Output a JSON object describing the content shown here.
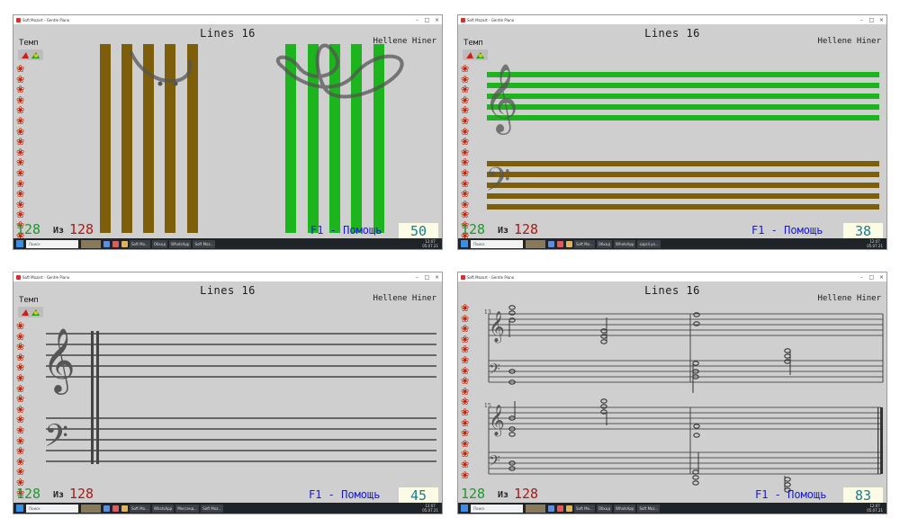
{
  "windows": [
    {
      "title_bar": "Soft Mozart - Gentle Piano",
      "lines_title": "Lines 16",
      "author": "Hellene Hiner",
      "tempo_label": "Темп",
      "count_green": "128",
      "count_sep": "Из",
      "count_red": "128",
      "help": "F1 - Помощь",
      "score": "50",
      "view": "vertical-bars"
    },
    {
      "title_bar": "Soft Mozart - Gentle Piano",
      "lines_title": "Lines 16",
      "author": "Hellene Hiner",
      "tempo_label": "Темп",
      "count_green": "128",
      "count_sep": "Из",
      "count_red": "128",
      "help": "F1 - Помощь",
      "score": "38",
      "view": "colored-staff"
    },
    {
      "title_bar": "Soft Mozart - Gentle Piano",
      "lines_title": "Lines 16",
      "author": "Hellene Hiner",
      "tempo_label": "Темп",
      "count_green": "128",
      "count_sep": "Из",
      "count_red": "128",
      "help": "F1 - Помощь",
      "score": "45",
      "view": "empty-staff"
    },
    {
      "title_bar": "Soft Mozart - Gentle Piano",
      "lines_title": "Lines 16",
      "author": "Hellene Hiner",
      "tempo_label": "",
      "count_green": "128",
      "count_sep": "Из",
      "count_red": "128",
      "help": "F1 - Помощь",
      "score": "83",
      "view": "sheet-music",
      "measure_numbers": [
        "13",
        "15"
      ]
    }
  ],
  "taskbar": {
    "search_placeholder": "Поиск",
    "apps": [
      "Soft Mo...",
      "Обход",
      "WhatsApp",
      "Мессенд...",
      "Soft Moz...",
      "sapsil.yo..."
    ],
    "clock_time": "12:07",
    "clock_date": "05.07.21",
    "lang": "РУС"
  },
  "colors": {
    "green": "#1db51d",
    "olive": "#7d5e0a",
    "flower": "#cc2200",
    "help": "#1a1acf",
    "score": "#167f8c"
  },
  "icons": [
    "flower-icon",
    "tempo-meter-icon",
    "treble-clef-icon",
    "bass-clef-icon",
    "windows-start-icon",
    "search-icon"
  ]
}
